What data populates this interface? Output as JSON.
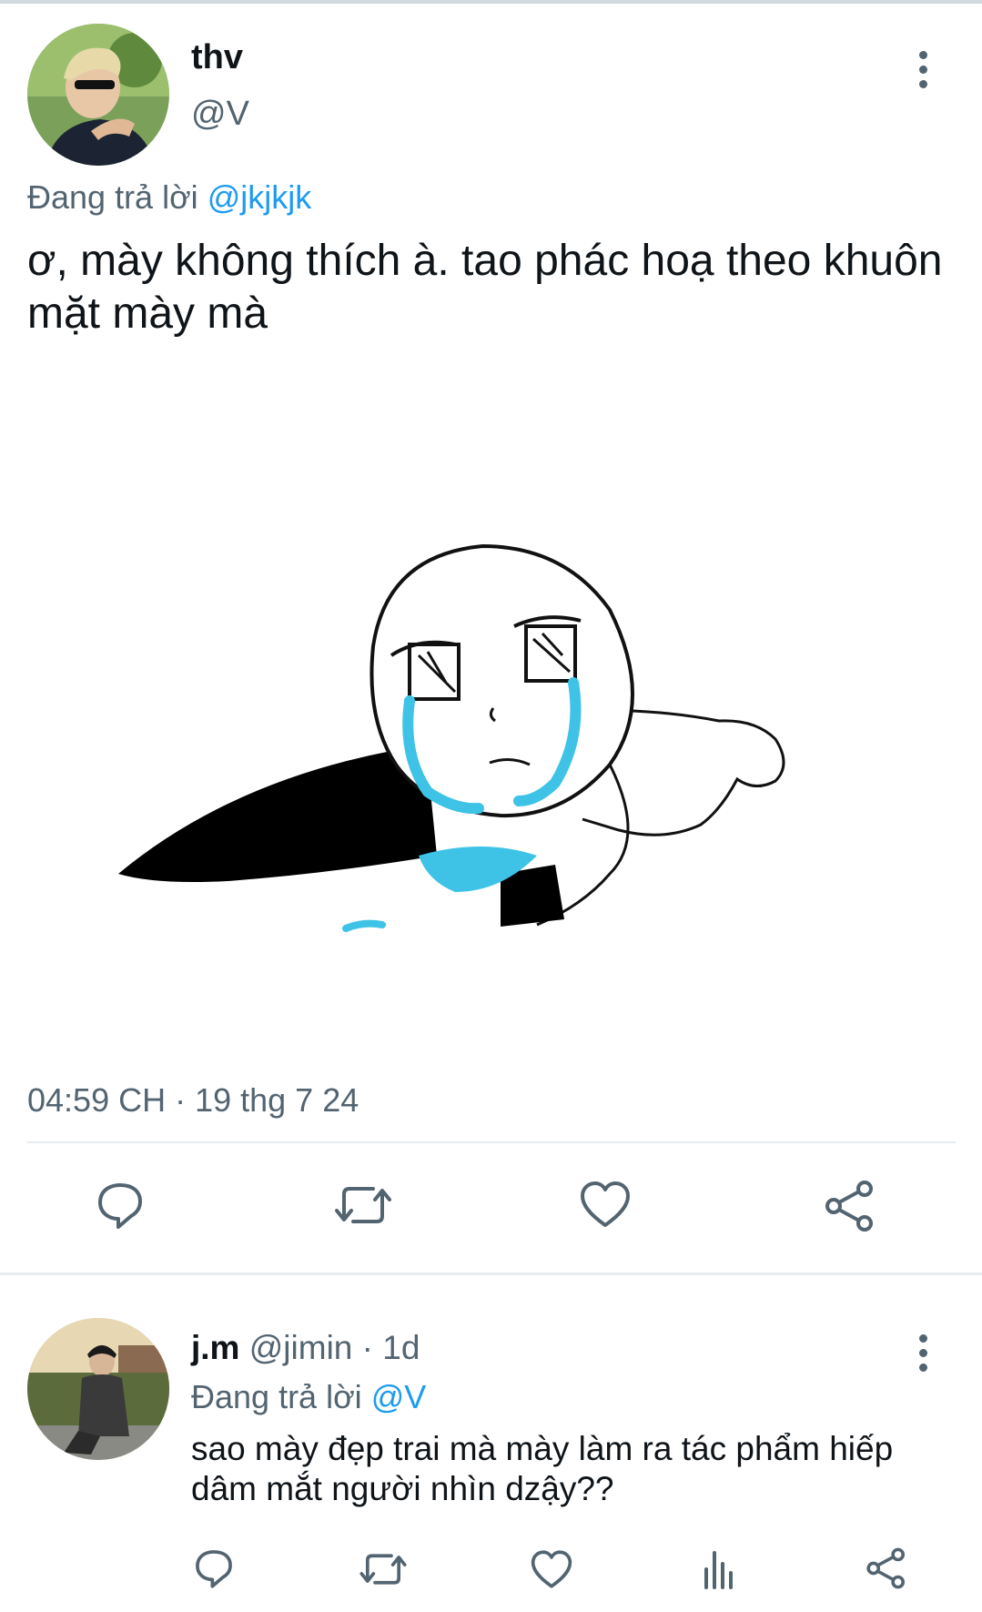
{
  "tweet": {
    "author_name": "thv",
    "author_handle": "@V",
    "replying_prefix": "Đang trả lời",
    "replying_to": "@jkjkjk",
    "text": "ơ, mày không thích à. tao phác hoạ theo khuôn mặt mày mà",
    "timestamp": "04:59 CH · 19 thg 7 24",
    "actions": [
      "reply-icon",
      "retweet-icon",
      "like-icon",
      "share-icon"
    ]
  },
  "reply": {
    "author_name": "j.m",
    "author_handle": "@jimin",
    "time": "· 1d",
    "replying_prefix": "Đang trả lời",
    "replying_to": "@V",
    "text": "sao mày đẹp trai mà mày làm ra tác phẩm hiếp dâm mắt người nhìn dzậy??",
    "actions": [
      "reply-icon",
      "retweet-icon",
      "like-icon",
      "analytics-icon",
      "share-icon"
    ]
  },
  "colors": {
    "accent": "#1d9bf0",
    "muted": "#536471",
    "text": "#0f1419",
    "tear": "#3ec3e6"
  }
}
